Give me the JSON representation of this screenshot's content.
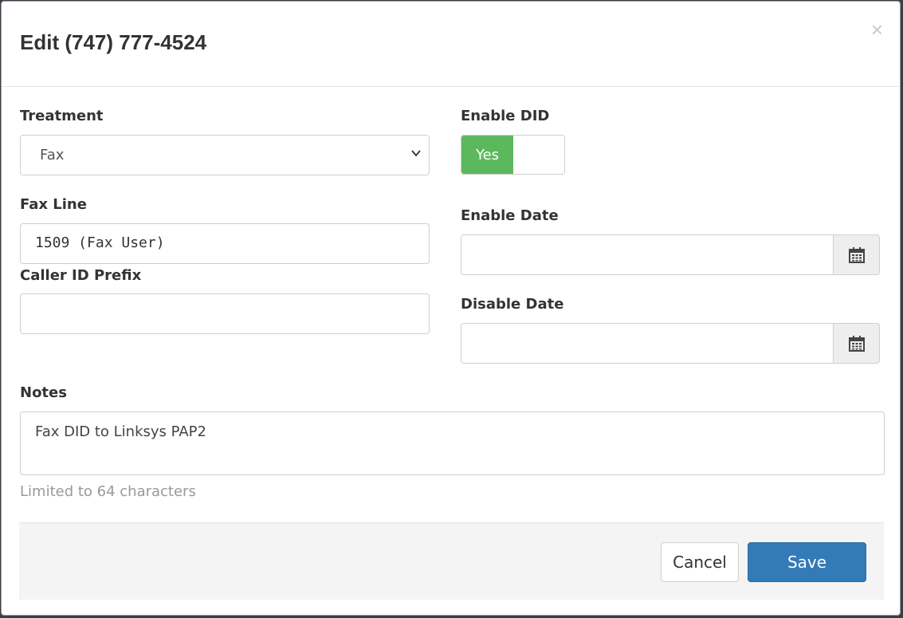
{
  "dialog": {
    "title": "Edit (747) 777-4524",
    "close_glyph": "×"
  },
  "treatment": {
    "label": "Treatment",
    "selected": "Fax"
  },
  "enable_did": {
    "label": "Enable DID",
    "state_label": "Yes",
    "on_color": "#5cb85c"
  },
  "fax_line": {
    "label": "Fax Line",
    "value": "1509 (Fax User)"
  },
  "caller_id_prefix": {
    "label": "Caller ID Prefix",
    "value": ""
  },
  "enable_date": {
    "label": "Enable Date",
    "value": "",
    "icon": "calendar-icon"
  },
  "disable_date": {
    "label": "Disable Date",
    "value": "",
    "icon": "calendar-icon"
  },
  "notes": {
    "label": "Notes",
    "value": "Fax DID to Linksys PAP2",
    "help": "Limited to 64 characters"
  },
  "footer": {
    "cancel_label": "Cancel",
    "save_label": "Save",
    "save_color": "#337ab7"
  }
}
